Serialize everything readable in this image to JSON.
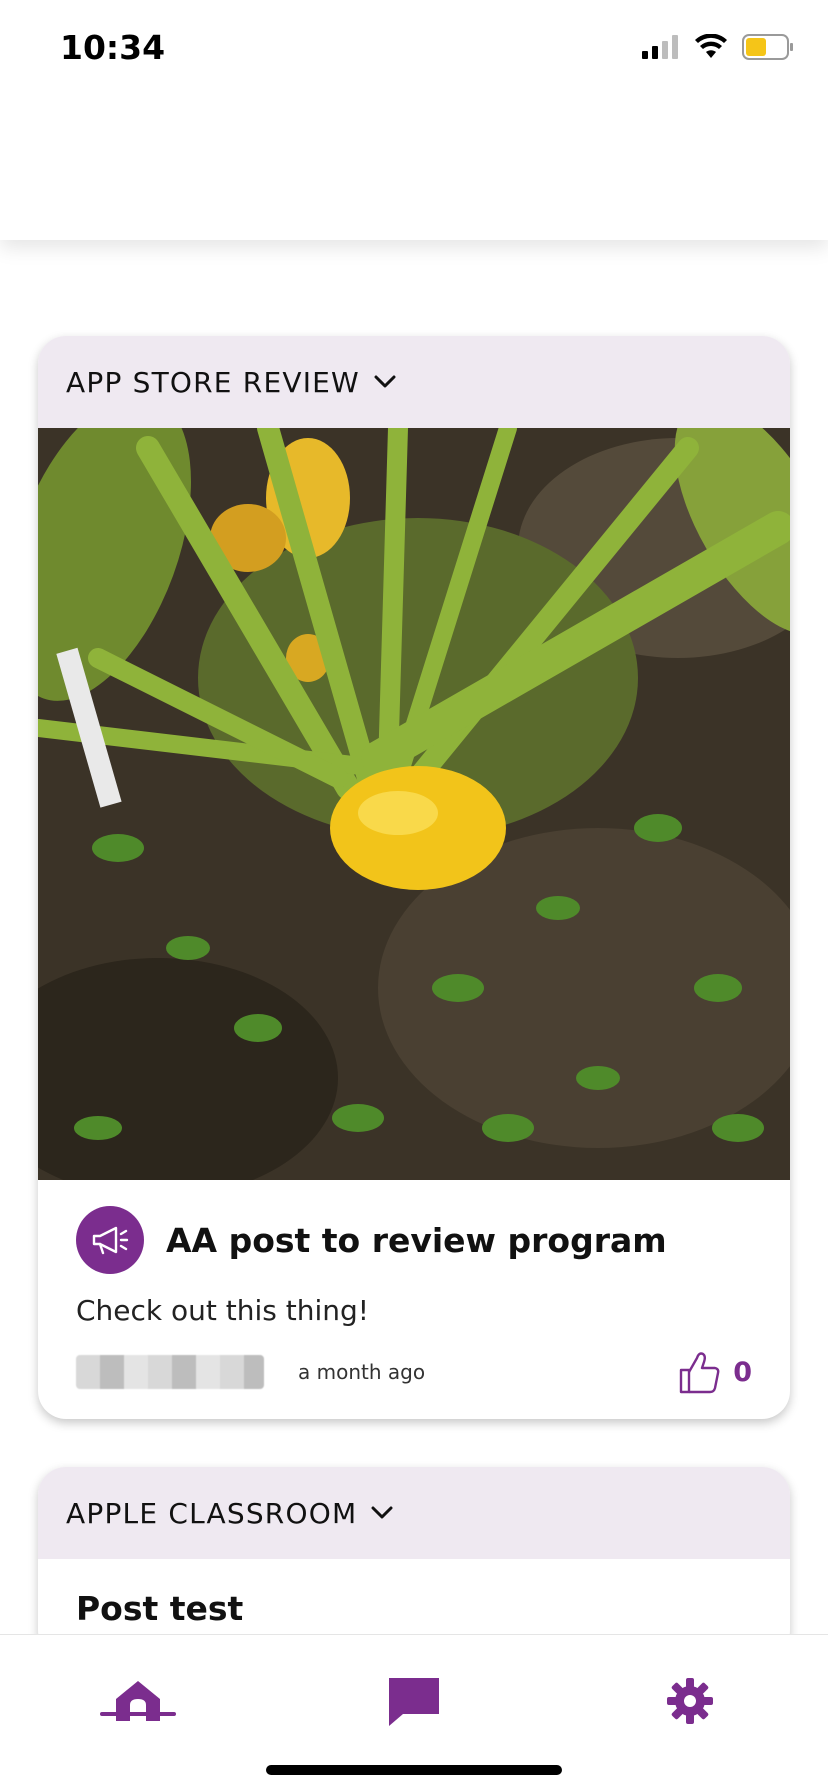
{
  "status_bar": {
    "time": "10:34",
    "signal_icon": "cellular-signal-icon",
    "wifi_icon": "wifi-icon",
    "battery_icon": "battery-icon",
    "battery_color": "#f5c518"
  },
  "colors": {
    "accent": "#7b2d8e",
    "card_header_bg": "#efe9f1"
  },
  "feed": {
    "cards": [
      {
        "group_name": "APP STORE REVIEW",
        "group_icon": "chevron-down-icon",
        "image_icon": "post-photo",
        "post_icon": "megaphone-icon",
        "post_title": "AA post to review program",
        "post_text": "Check out this thing!",
        "author": "",
        "time_ago": "a month ago",
        "like_icon": "thumbs-up-icon",
        "like_count": "0"
      },
      {
        "group_name": "APPLE CLASSROOM",
        "group_icon": "chevron-down-icon",
        "post_title": "Post test"
      }
    ]
  },
  "tab_bar": {
    "tabs": [
      {
        "name": "home",
        "icon": "home-icon",
        "active": true
      },
      {
        "name": "messages",
        "icon": "chat-bubble-icon",
        "active": false
      },
      {
        "name": "settings",
        "icon": "gear-icon",
        "active": false
      }
    ]
  }
}
